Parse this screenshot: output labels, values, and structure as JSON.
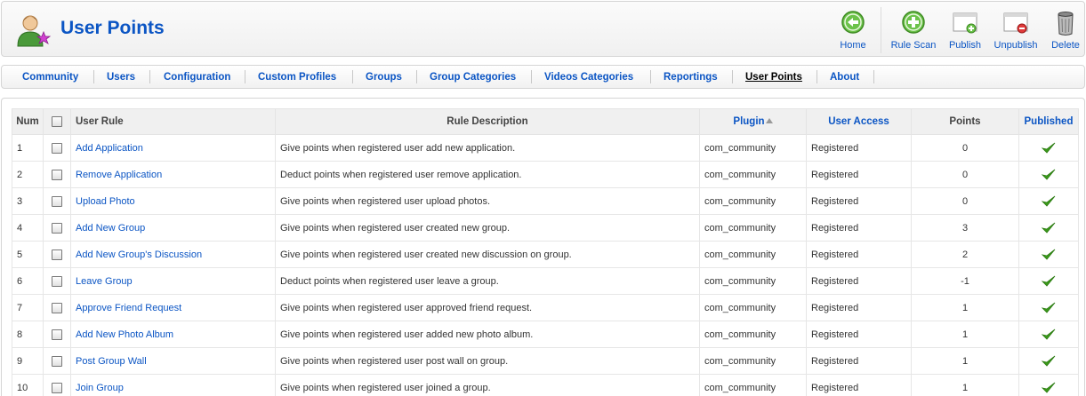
{
  "header": {
    "title": "User Points",
    "toolbar": [
      {
        "id": "home",
        "label": "Home",
        "icon": "home-arrow-icon"
      },
      {
        "id": "rule-scan",
        "label": "Rule Scan",
        "icon": "plus-circle-icon"
      },
      {
        "id": "publish",
        "label": "Publish",
        "icon": "publish-icon"
      },
      {
        "id": "unpublish",
        "label": "Unpublish",
        "icon": "unpublish-icon"
      },
      {
        "id": "delete",
        "label": "Delete",
        "icon": "trash-icon"
      }
    ]
  },
  "submenu": {
    "items": [
      {
        "label": "Community"
      },
      {
        "label": "Users"
      },
      {
        "label": "Configuration"
      },
      {
        "label": "Custom Profiles"
      },
      {
        "label": "Groups"
      },
      {
        "label": "Group Categories"
      },
      {
        "label": "Videos Categories"
      },
      {
        "label": "Reportings"
      },
      {
        "label": "User Points",
        "active": true
      },
      {
        "label": "About"
      }
    ]
  },
  "table": {
    "columns": {
      "num": "Num",
      "user_rule": "User Rule",
      "rule_description": "Rule Description",
      "plugin": "Plugin",
      "user_access": "User Access",
      "points": "Points",
      "published": "Published"
    },
    "rows": [
      {
        "num": "1",
        "rule": "Add Application",
        "description": "Give points when registered user add new application.",
        "plugin": "com_community",
        "access": "Registered",
        "points": "0",
        "published": true
      },
      {
        "num": "2",
        "rule": "Remove Application",
        "description": "Deduct points when registered user remove application.",
        "plugin": "com_community",
        "access": "Registered",
        "points": "0",
        "published": true
      },
      {
        "num": "3",
        "rule": "Upload Photo",
        "description": "Give points when registered user upload photos.",
        "plugin": "com_community",
        "access": "Registered",
        "points": "0",
        "published": true
      },
      {
        "num": "4",
        "rule": "Add New Group",
        "description": "Give points when registered user created new group.",
        "plugin": "com_community",
        "access": "Registered",
        "points": "3",
        "published": true
      },
      {
        "num": "5",
        "rule": "Add New Group's Discussion",
        "description": "Give points when registered user created new discussion on group.",
        "plugin": "com_community",
        "access": "Registered",
        "points": "2",
        "published": true
      },
      {
        "num": "6",
        "rule": "Leave Group",
        "description": "Deduct points when registered user leave a group.",
        "plugin": "com_community",
        "access": "Registered",
        "points": "-1",
        "published": true
      },
      {
        "num": "7",
        "rule": "Approve Friend Request",
        "description": "Give points when registered user approved friend request.",
        "plugin": "com_community",
        "access": "Registered",
        "points": "1",
        "published": true
      },
      {
        "num": "8",
        "rule": "Add New Photo Album",
        "description": "Give points when registered user added new photo album.",
        "plugin": "com_community",
        "access": "Registered",
        "points": "1",
        "published": true
      },
      {
        "num": "9",
        "rule": "Post Group Wall",
        "description": "Give points when registered user post wall on group.",
        "plugin": "com_community",
        "access": "Registered",
        "points": "1",
        "published": true
      },
      {
        "num": "10",
        "rule": "Join Group",
        "description": "Give points when registered user joined a group.",
        "plugin": "com_community",
        "access": "Registered",
        "points": "1",
        "published": true
      }
    ]
  },
  "colors": {
    "link": "#0b55c4",
    "published_check": "#3a9a1a"
  }
}
